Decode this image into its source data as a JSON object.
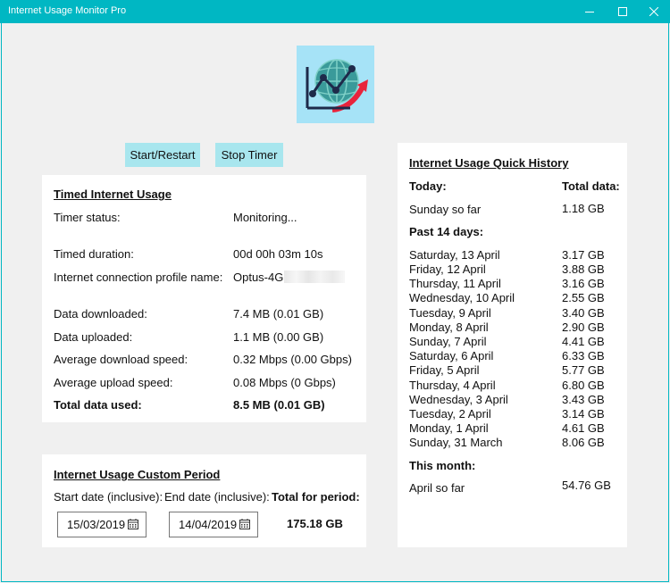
{
  "window": {
    "title": "Internet Usage Monitor Pro"
  },
  "controls": {
    "start_label": "Start/Restart",
    "stop_label": "Stop Timer"
  },
  "timed": {
    "heading": "Timed Internet Usage",
    "rows": [
      {
        "label": "Timer status:",
        "value": "Monitoring..."
      },
      {
        "label": "Timed duration:",
        "value": "00d 00h 03m 10s"
      },
      {
        "label": "Internet connection profile name:",
        "value": "Optus-4G"
      },
      {
        "label": "Data downloaded:",
        "value": "7.4 MB (0.01 GB)"
      },
      {
        "label": "Data uploaded:",
        "value": "1.1 MB (0.00 GB)"
      },
      {
        "label": "Average download speed:",
        "value": "0.32 Mbps (0.00 Gbps)"
      },
      {
        "label": "Average upload speed:",
        "value": "0.08 Mbps (0 Gbps)"
      }
    ],
    "total_label": "Total data used:",
    "total_value": "8.5 MB (0.01 GB)"
  },
  "custom": {
    "heading": "Internet Usage Custom Period",
    "start_label": "Start date (inclusive):",
    "end_label": "End date (inclusive):",
    "total_label": "Total for period:",
    "start_date": "15/03/2019",
    "end_date": "14/04/2019",
    "total_value": "175.18 GB"
  },
  "history": {
    "heading": "Internet Usage Quick History",
    "today_label": "Today:",
    "total_data_label": "Total data:",
    "today_row": {
      "day": "Sunday so far",
      "value": "1.18 GB"
    },
    "past_label": "Past 14 days:",
    "past": [
      {
        "day": "Saturday, 13 April",
        "value": "3.17 GB"
      },
      {
        "day": "Friday, 12 April",
        "value": "3.88 GB"
      },
      {
        "day": "Thursday, 11 April",
        "value": "3.16 GB"
      },
      {
        "day": "Wednesday, 10 April",
        "value": "2.55 GB"
      },
      {
        "day": "Tuesday, 9 April",
        "value": "3.40 GB"
      },
      {
        "day": "Monday, 8 April",
        "value": "2.90 GB"
      },
      {
        "day": "Sunday, 7 April",
        "value": "4.41 GB"
      },
      {
        "day": "Saturday, 6 April",
        "value": "6.33 GB"
      },
      {
        "day": "Friday, 5 April",
        "value": "5.77 GB"
      },
      {
        "day": "Thursday, 4 April",
        "value": "6.80 GB"
      },
      {
        "day": "Wednesday, 3 April",
        "value": "3.43 GB"
      },
      {
        "day": "Tuesday, 2 April",
        "value": "3.14 GB"
      },
      {
        "day": "Monday, 1 April",
        "value": "4.61 GB"
      },
      {
        "day": "Sunday, 31 March",
        "value": "8.06 GB"
      }
    ],
    "month_label": "This month:",
    "month_row": {
      "day": "April so far",
      "value": "54.76 GB"
    }
  },
  "icons": {
    "minimize": "minimize-icon",
    "maximize": "maximize-icon",
    "close": "close-icon",
    "logo": "app-logo-chart-globe-icon",
    "calendar": "calendar-icon"
  },
  "colors": {
    "titlebar": "#00b7c3",
    "button": "#a8e6ee",
    "logo_bg": "#a6e3f7"
  }
}
